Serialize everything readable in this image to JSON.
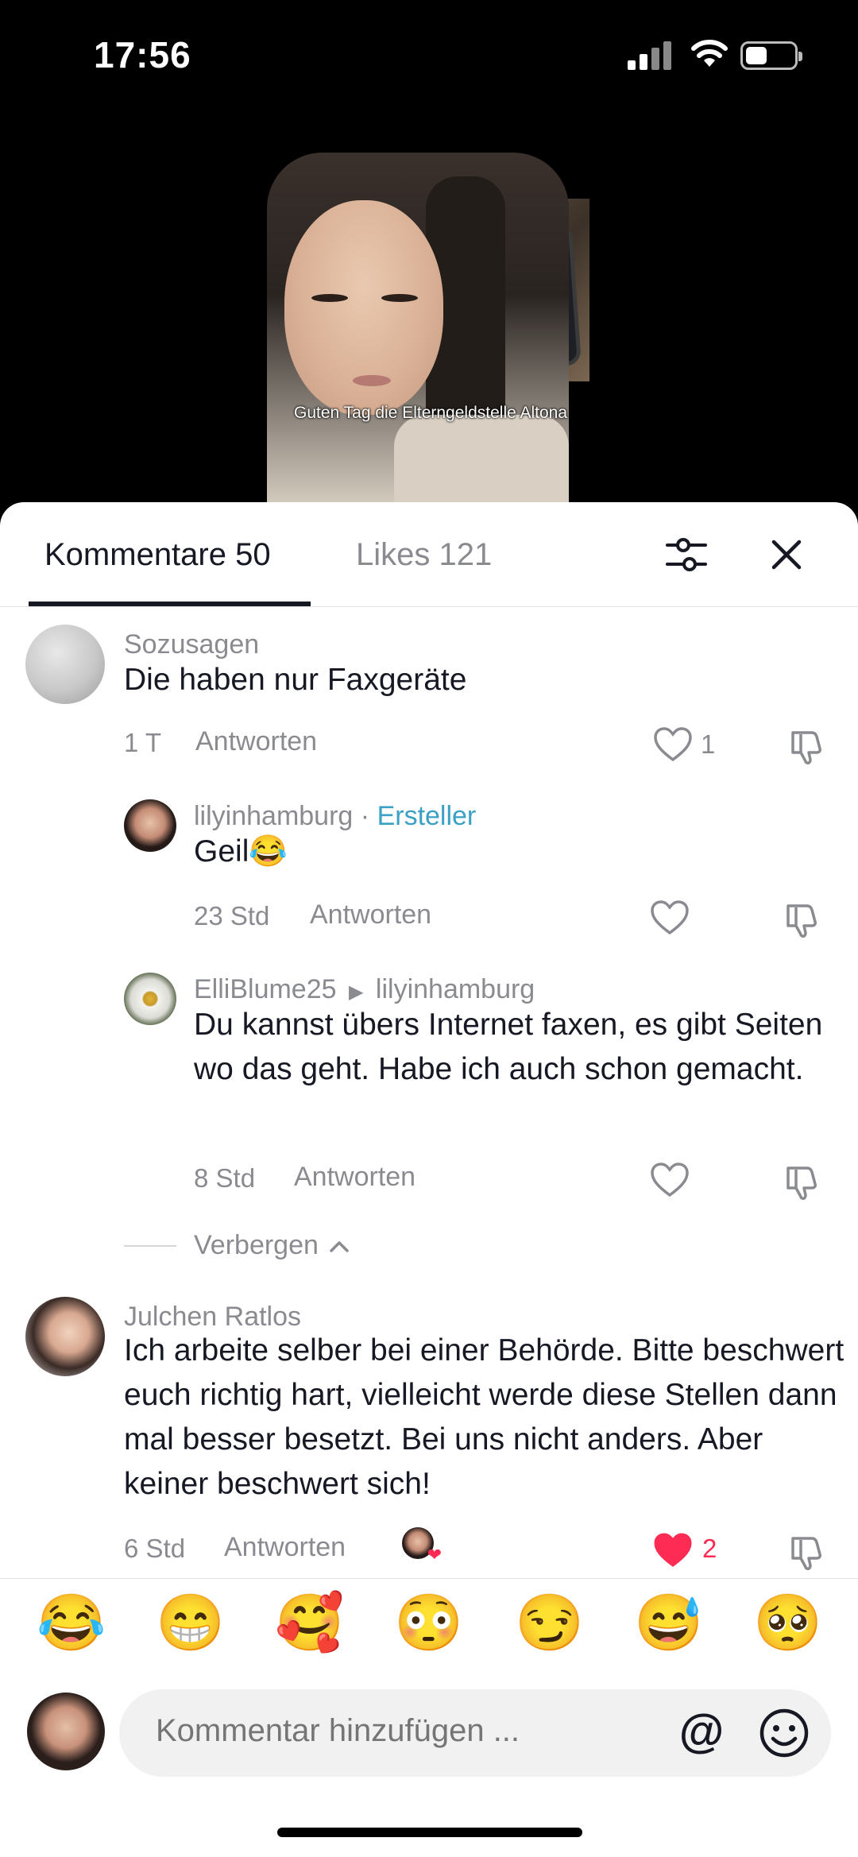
{
  "status_bar": {
    "time": "17:56",
    "battery_level": 0.45
  },
  "video": {
    "caption": "Guten Tag die Elterngeldstelle Altona"
  },
  "tabs": {
    "comments": "Kommentare 50",
    "likes": "Likes 121"
  },
  "comments": [
    {
      "user": "Sozusagen",
      "text": "Die haben nur Faxgeräte",
      "time": "1 T",
      "reply": "Antworten",
      "likes": "1",
      "liked": false
    },
    {
      "user": "lilyinhamburg",
      "separator": "·",
      "badge": "Ersteller",
      "text": "Geil😂",
      "time": "23 Std",
      "reply": "Antworten",
      "likes": "",
      "liked": false
    },
    {
      "user": "ElliBlume25",
      "reply_to": "lilyinhamburg",
      "text": "Du kannst übers Internet faxen, es gibt Seiten wo das geht. Habe ich auch schon gemacht.",
      "time": "8 Std",
      "reply": "Antworten",
      "likes": "",
      "liked": false
    },
    {
      "user": "Julchen Ratlos",
      "text": "Ich arbeite selber bei einer Behörde. Bitte beschwert euch richtig hart, vielleicht werde diese Stellen dann mal besser besetzt. Bei uns nicht anders. Aber keiner beschwert sich!",
      "time": "6 Std",
      "reply": "Antworten",
      "likes": "2",
      "liked": true
    }
  ],
  "hide_replies": "Verbergen",
  "emojis": [
    "😂",
    "😁",
    "🥰",
    "😳",
    "😏",
    "😅",
    "🥺"
  ],
  "input": {
    "placeholder": "Kommentar hinzufügen ...",
    "at_symbol": "@"
  },
  "colors": {
    "accent": "#fe2c55",
    "creator": "#3aa0c4",
    "muted": "#8a8b91"
  }
}
